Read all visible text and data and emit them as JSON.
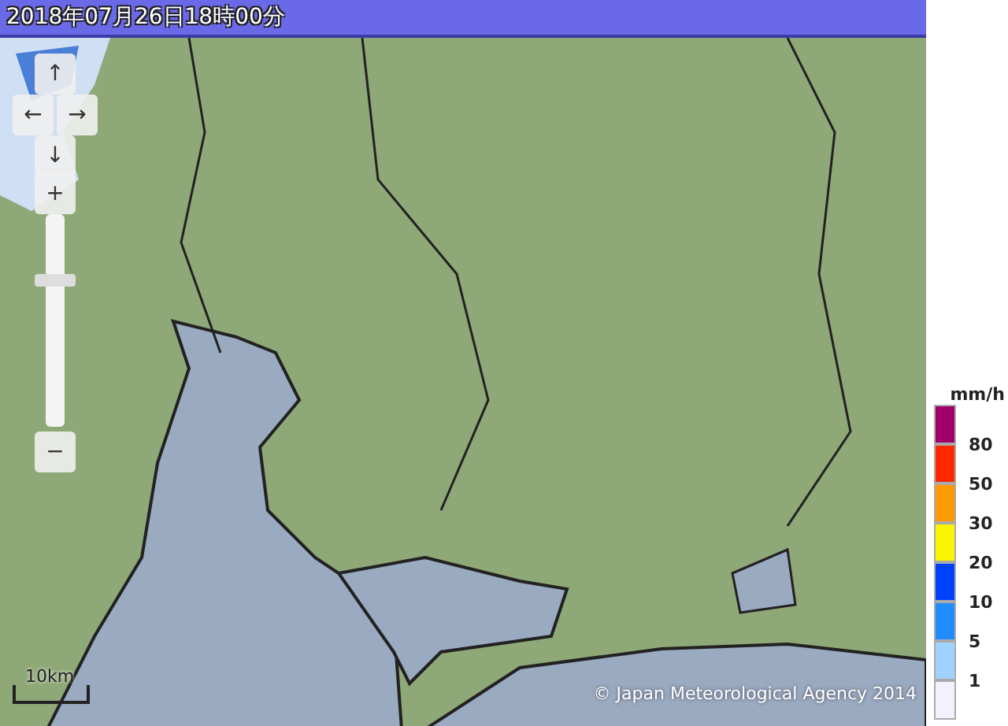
{
  "header": {
    "title": "2018年07月26日18時00分"
  },
  "controls": {
    "pan": [
      "↑",
      "←",
      "→",
      "↓"
    ],
    "zoom_in": "+",
    "zoom_out": "−",
    "zoom": {
      "level": 0.7
    }
  },
  "scale": {
    "label": "10km"
  },
  "copyright": "© Japan Meteorological Agency 2014",
  "legend": {
    "unit": "mm/h",
    "bands": [
      {
        "color": "#a0006a",
        "label": "80"
      },
      {
        "color": "#ff2800",
        "label": "50"
      },
      {
        "color": "#ff9900",
        "label": "30"
      },
      {
        "color": "#faf500",
        "label": "20"
      },
      {
        "color": "#0041ff",
        "label": "10"
      },
      {
        "color": "#218cff",
        "label": "5"
      },
      {
        "color": "#a0d2ff",
        "label": "1"
      },
      {
        "color": "#f2f2ff"
      }
    ]
  }
}
